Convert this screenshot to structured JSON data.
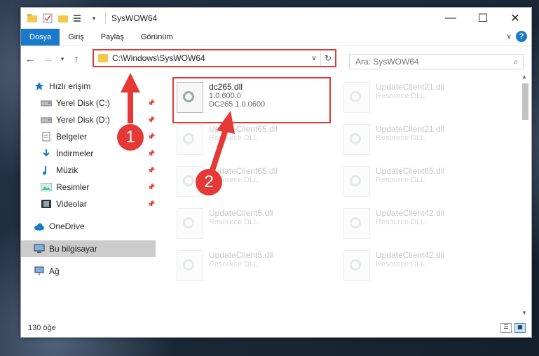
{
  "window": {
    "title": "SysWOW64",
    "minimize": "—",
    "maximize": "☐",
    "close": "✕"
  },
  "ribbon": {
    "tabs": [
      "Dosya",
      "Giriş",
      "Paylaş",
      "Görünüm"
    ],
    "help": "?"
  },
  "address": {
    "path": "C:\\Windows\\SysWOW64"
  },
  "search": {
    "placeholder": "Ara: SysWOW64"
  },
  "sidebar": {
    "items": [
      {
        "label": "Hızlı erişim",
        "icon": "star-icon"
      },
      {
        "label": "Yerel Disk (C:)",
        "icon": "drive-icon",
        "pinned": true
      },
      {
        "label": "Yerel Disk (D:)",
        "icon": "drive-icon",
        "pinned": true
      },
      {
        "label": "Belgeler",
        "icon": "documents-icon",
        "pinned": true
      },
      {
        "label": "İndirmeler",
        "icon": "download-icon",
        "pinned": true
      },
      {
        "label": "Müzik",
        "icon": "music-icon",
        "pinned": true
      },
      {
        "label": "Resimler",
        "icon": "pictures-icon",
        "pinned": true
      },
      {
        "label": "Videolar",
        "icon": "videos-icon",
        "pinned": true
      },
      {
        "label": "OneDrive",
        "icon": "cloud-icon"
      },
      {
        "label": "Bu bilgisayar",
        "icon": "computer-icon",
        "selected": true
      },
      {
        "label": "Ağ",
        "icon": "network-icon"
      }
    ]
  },
  "files": [
    {
      "name": "dc265.dll",
      "line1": "1.0.600.0",
      "line2": "DC265 1.0.0600",
      "highlight": true
    },
    {
      "name": "UpdateClient21.dll",
      "line1": "Resource DLL"
    },
    {
      "name": "UpdateClient65.dll",
      "line1": "Resource DLL"
    },
    {
      "name": "UpdateClient21.dll",
      "line1": "Resource DLL"
    },
    {
      "name": "UpdateClient65.dll",
      "line1": "Resource DLL"
    },
    {
      "name": "UpdateClient65.dll",
      "line1": "Resource DLL"
    },
    {
      "name": "UpdateClient5.dll",
      "line1": "Resource DLL"
    },
    {
      "name": "UpdateClient42.dll",
      "line1": "Resource DLL"
    },
    {
      "name": "UpdateClient5.dll",
      "line1": "Resource DLL"
    },
    {
      "name": "UpdateClient42.dll",
      "line1": "Resource DLL"
    }
  ],
  "status": {
    "count": "130 öğe"
  },
  "annotations": {
    "badge1": "1",
    "badge2": "2"
  },
  "colors": {
    "accent": "#1979ca",
    "annotation": "#e53935"
  }
}
